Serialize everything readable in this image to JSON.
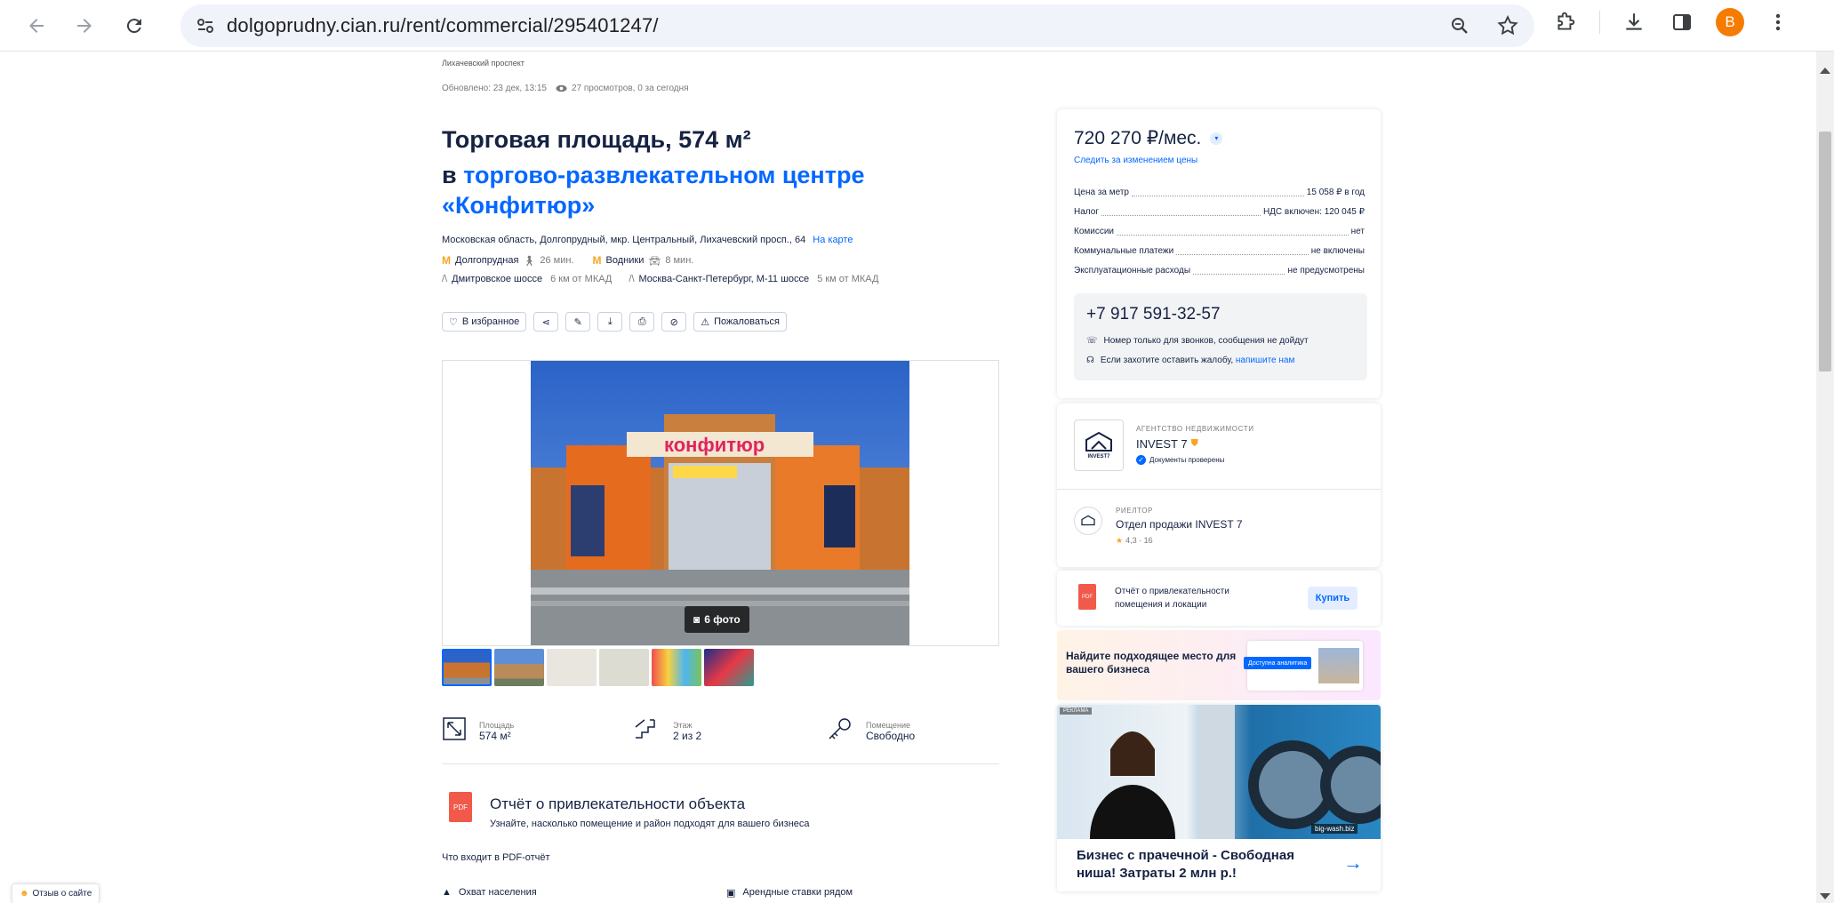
{
  "browser": {
    "url": "dolgoprudny.cian.ru/rent/commercial/295401247/",
    "profile_initial": "B",
    "accent": "#f57c00"
  },
  "listing": {
    "address_top": "Лихачевский проспект",
    "updated": "Обновлено: 23 дек, 13:15",
    "views": "27 просмотров, 0 за сегодня",
    "title": "Торговая площадь, 574 м²",
    "title_prefix": "в ",
    "title_link": "торгово-развлекательном центре «Конфитюр»",
    "address": "Московская область, Долгопрудный, мкр. Центральный, Лихачевский просп., 64",
    "map_link": "На карте",
    "metro": [
      {
        "name": "Долгопрудная",
        "time": "26 мин.",
        "mode": "walk"
      },
      {
        "name": "Водники",
        "time": "8 мин.",
        "mode": "car"
      }
    ],
    "highways": [
      {
        "name": "Дмитровское шоссе",
        "dist": "6 км от МКАД"
      },
      {
        "name": "Москва-Санкт-Петербург, М-11 шоссе",
        "dist": "5 км от МКАД"
      }
    ],
    "actions": {
      "favorite": "В избранное",
      "complain": "Пожаловаться"
    },
    "photo_count": "6 фото",
    "features": [
      {
        "label": "Площадь",
        "value": "574 м²",
        "icon": "area-icon"
      },
      {
        "label": "Этаж",
        "value": "2 из 2",
        "icon": "stairs-icon"
      },
      {
        "label": "Помещение",
        "value": "Свободно",
        "icon": "key-icon"
      }
    ],
    "report": {
      "title": "Отчёт о привлекательности объекта",
      "subtitle": "Узнайте, насколько помещение и район подходят для вашего бизнеса",
      "pdf": "PDF",
      "includes_title": "Что входит в PDF-отчёт",
      "items": [
        "Охват населения",
        "Арендные ставки рядом"
      ]
    }
  },
  "sidebar": {
    "price": "720 270 ₽/мес.",
    "watch_price": "Следить за изменением цены",
    "rows": [
      {
        "label": "Цена за метр",
        "value": "15 058 ₽ в год"
      },
      {
        "label": "Налог",
        "value": "НДС включен: 120 045 ₽"
      },
      {
        "label": "Комиссии",
        "value": "нет"
      },
      {
        "label": "Коммунальные платежи",
        "value": "не включены"
      },
      {
        "label": "Эксплуатационные расходы",
        "value": "не предусмотрены"
      }
    ],
    "phone": "+7 917 591-32-57",
    "phone_note": "Номер только для звонков, сообщения не дойдут",
    "complaint_prefix": "Если захотите оставить жалобу, ",
    "complaint_link": "напишите нам",
    "agency": {
      "caption": "АГЕНТСТВО НЕДВИЖИМОСТИ",
      "name": "INVEST 7",
      "logo_text": "INVEST7",
      "verified": "Документы проверены"
    },
    "realtor": {
      "caption": "РИЕЛТОР",
      "name": "Отдел продажи INVEST 7",
      "rating": "4,3 · 16"
    },
    "report_card": {
      "text": "Отчёт о привлекательности помещения и локации",
      "button": "Купить",
      "pdf": "PDF"
    },
    "promo": {
      "text": "Найдите подходящее место для вашего бизнеса",
      "badge": "Доступна аналитика"
    },
    "ad": {
      "label": "РЕКЛАМА",
      "brand": "big-wash.biz",
      "text": "Бизнес с прачечной - Свободная ниша! Затраты 2 млн р.!"
    }
  },
  "feedback": "Отзыв о сайте"
}
